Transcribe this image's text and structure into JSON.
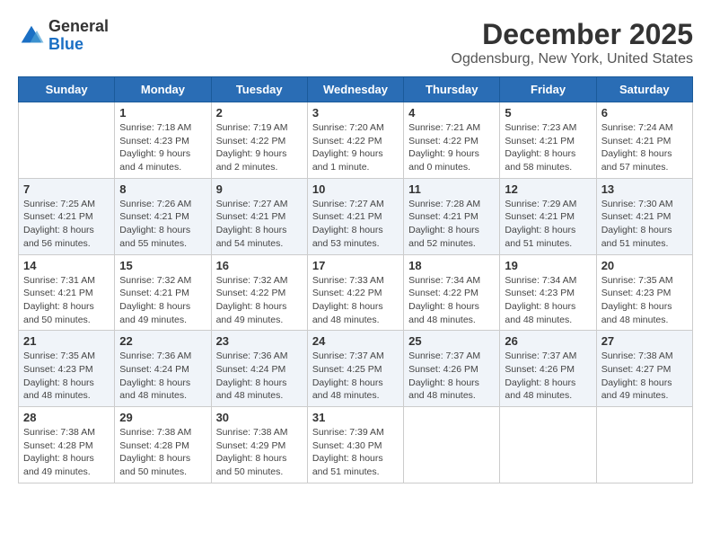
{
  "logo": {
    "general": "General",
    "blue": "Blue"
  },
  "title": "December 2025",
  "subtitle": "Ogdensburg, New York, United States",
  "weekdays": [
    "Sunday",
    "Monday",
    "Tuesday",
    "Wednesday",
    "Thursday",
    "Friday",
    "Saturday"
  ],
  "weeks": [
    [
      {
        "day": "",
        "info": ""
      },
      {
        "day": "1",
        "info": "Sunrise: 7:18 AM\nSunset: 4:23 PM\nDaylight: 9 hours\nand 4 minutes."
      },
      {
        "day": "2",
        "info": "Sunrise: 7:19 AM\nSunset: 4:22 PM\nDaylight: 9 hours\nand 2 minutes."
      },
      {
        "day": "3",
        "info": "Sunrise: 7:20 AM\nSunset: 4:22 PM\nDaylight: 9 hours\nand 1 minute."
      },
      {
        "day": "4",
        "info": "Sunrise: 7:21 AM\nSunset: 4:22 PM\nDaylight: 9 hours\nand 0 minutes."
      },
      {
        "day": "5",
        "info": "Sunrise: 7:23 AM\nSunset: 4:21 PM\nDaylight: 8 hours\nand 58 minutes."
      },
      {
        "day": "6",
        "info": "Sunrise: 7:24 AM\nSunset: 4:21 PM\nDaylight: 8 hours\nand 57 minutes."
      }
    ],
    [
      {
        "day": "7",
        "info": "Sunrise: 7:25 AM\nSunset: 4:21 PM\nDaylight: 8 hours\nand 56 minutes."
      },
      {
        "day": "8",
        "info": "Sunrise: 7:26 AM\nSunset: 4:21 PM\nDaylight: 8 hours\nand 55 minutes."
      },
      {
        "day": "9",
        "info": "Sunrise: 7:27 AM\nSunset: 4:21 PM\nDaylight: 8 hours\nand 54 minutes."
      },
      {
        "day": "10",
        "info": "Sunrise: 7:27 AM\nSunset: 4:21 PM\nDaylight: 8 hours\nand 53 minutes."
      },
      {
        "day": "11",
        "info": "Sunrise: 7:28 AM\nSunset: 4:21 PM\nDaylight: 8 hours\nand 52 minutes."
      },
      {
        "day": "12",
        "info": "Sunrise: 7:29 AM\nSunset: 4:21 PM\nDaylight: 8 hours\nand 51 minutes."
      },
      {
        "day": "13",
        "info": "Sunrise: 7:30 AM\nSunset: 4:21 PM\nDaylight: 8 hours\nand 51 minutes."
      }
    ],
    [
      {
        "day": "14",
        "info": "Sunrise: 7:31 AM\nSunset: 4:21 PM\nDaylight: 8 hours\nand 50 minutes."
      },
      {
        "day": "15",
        "info": "Sunrise: 7:32 AM\nSunset: 4:21 PM\nDaylight: 8 hours\nand 49 minutes."
      },
      {
        "day": "16",
        "info": "Sunrise: 7:32 AM\nSunset: 4:22 PM\nDaylight: 8 hours\nand 49 minutes."
      },
      {
        "day": "17",
        "info": "Sunrise: 7:33 AM\nSunset: 4:22 PM\nDaylight: 8 hours\nand 48 minutes."
      },
      {
        "day": "18",
        "info": "Sunrise: 7:34 AM\nSunset: 4:22 PM\nDaylight: 8 hours\nand 48 minutes."
      },
      {
        "day": "19",
        "info": "Sunrise: 7:34 AM\nSunset: 4:23 PM\nDaylight: 8 hours\nand 48 minutes."
      },
      {
        "day": "20",
        "info": "Sunrise: 7:35 AM\nSunset: 4:23 PM\nDaylight: 8 hours\nand 48 minutes."
      }
    ],
    [
      {
        "day": "21",
        "info": "Sunrise: 7:35 AM\nSunset: 4:23 PM\nDaylight: 8 hours\nand 48 minutes."
      },
      {
        "day": "22",
        "info": "Sunrise: 7:36 AM\nSunset: 4:24 PM\nDaylight: 8 hours\nand 48 minutes."
      },
      {
        "day": "23",
        "info": "Sunrise: 7:36 AM\nSunset: 4:24 PM\nDaylight: 8 hours\nand 48 minutes."
      },
      {
        "day": "24",
        "info": "Sunrise: 7:37 AM\nSunset: 4:25 PM\nDaylight: 8 hours\nand 48 minutes."
      },
      {
        "day": "25",
        "info": "Sunrise: 7:37 AM\nSunset: 4:26 PM\nDaylight: 8 hours\nand 48 minutes."
      },
      {
        "day": "26",
        "info": "Sunrise: 7:37 AM\nSunset: 4:26 PM\nDaylight: 8 hours\nand 48 minutes."
      },
      {
        "day": "27",
        "info": "Sunrise: 7:38 AM\nSunset: 4:27 PM\nDaylight: 8 hours\nand 49 minutes."
      }
    ],
    [
      {
        "day": "28",
        "info": "Sunrise: 7:38 AM\nSunset: 4:28 PM\nDaylight: 8 hours\nand 49 minutes."
      },
      {
        "day": "29",
        "info": "Sunrise: 7:38 AM\nSunset: 4:28 PM\nDaylight: 8 hours\nand 50 minutes."
      },
      {
        "day": "30",
        "info": "Sunrise: 7:38 AM\nSunset: 4:29 PM\nDaylight: 8 hours\nand 50 minutes."
      },
      {
        "day": "31",
        "info": "Sunrise: 7:39 AM\nSunset: 4:30 PM\nDaylight: 8 hours\nand 51 minutes."
      },
      {
        "day": "",
        "info": ""
      },
      {
        "day": "",
        "info": ""
      },
      {
        "day": "",
        "info": ""
      }
    ]
  ]
}
